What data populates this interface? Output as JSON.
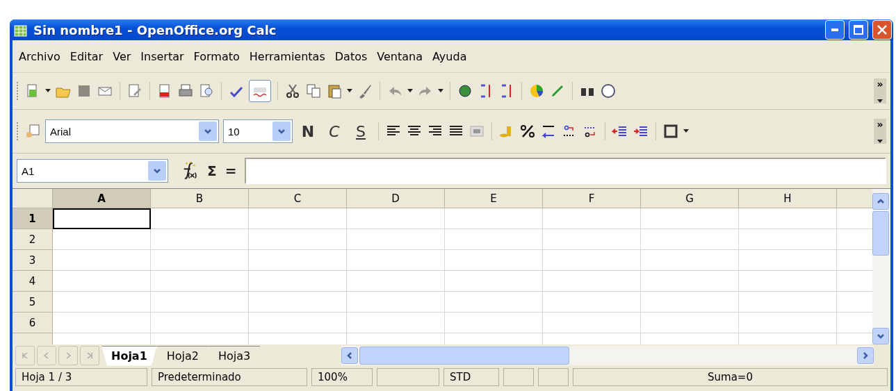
{
  "window": {
    "title": "Sin nombre1 - OpenOffice.org Calc"
  },
  "menu": [
    {
      "label": "Archivo"
    },
    {
      "label": "Editar"
    },
    {
      "label": "Ver"
    },
    {
      "label": "Insertar"
    },
    {
      "label": "Formato"
    },
    {
      "label": "Herramientas"
    },
    {
      "label": "Datos"
    },
    {
      "label": "Ventana"
    },
    {
      "label": "Ayuda"
    }
  ],
  "standard_toolbar": {
    "autospell_selected": true,
    "overflow_label": "»"
  },
  "format_toolbar": {
    "overflow_label": "»",
    "font": "Arial",
    "size": "10",
    "style_buttons": [
      {
        "kind": "bold",
        "label": "N"
      },
      {
        "kind": "italic",
        "label": "C"
      },
      {
        "kind": "underline",
        "label": "S"
      }
    ]
  },
  "formula_bar": {
    "name_box": "A1",
    "sum_label": "Σ",
    "equals_label": "="
  },
  "grid": {
    "columns": [
      {
        "label": "A",
        "selected": true
      },
      {
        "label": "B",
        "selected": false
      },
      {
        "label": "C",
        "selected": false
      },
      {
        "label": "D",
        "selected": false
      },
      {
        "label": "E",
        "selected": false
      },
      {
        "label": "F",
        "selected": false
      },
      {
        "label": "G",
        "selected": false
      },
      {
        "label": "H",
        "selected": false
      }
    ],
    "rows": [
      {
        "label": "1",
        "selected": true
      },
      {
        "label": "2",
        "selected": false
      },
      {
        "label": "3",
        "selected": false
      },
      {
        "label": "4",
        "selected": false
      },
      {
        "label": "5",
        "selected": false
      },
      {
        "label": "6",
        "selected": false
      }
    ]
  },
  "sheet_tabs": [
    {
      "label": "Hoja1",
      "selected": true
    },
    {
      "label": "Hoja2",
      "selected": false
    },
    {
      "label": "Hoja3",
      "selected": false
    }
  ],
  "status_bar": [
    {
      "kind": "text",
      "text": "Hoja 1 / 3"
    },
    {
      "kind": "text",
      "text": "Predeterminado"
    },
    {
      "kind": "text",
      "text": "100%"
    },
    {
      "kind": "empty"
    },
    {
      "kind": "text",
      "text": "STD"
    },
    {
      "kind": "empty"
    },
    {
      "kind": "empty"
    },
    {
      "kind": "wide",
      "text": "Suma=0"
    }
  ]
}
